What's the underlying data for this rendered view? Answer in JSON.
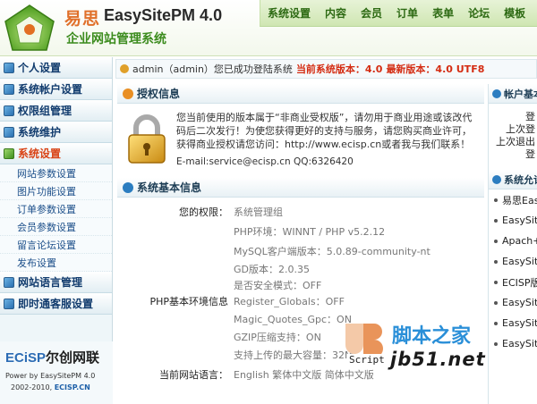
{
  "header": {
    "brand_cn": "易思",
    "brand_en": "EasySitePM 4.0",
    "subtitle": "企业网站管理系统",
    "nav": [
      "系统设置",
      "内容",
      "会员",
      "订单",
      "表单",
      "论坛",
      "模板"
    ]
  },
  "sidebar": {
    "sections": [
      {
        "label": "个人设置"
      },
      {
        "label": "系统帐户设置"
      },
      {
        "label": "权限组管理"
      },
      {
        "label": "系统维护"
      },
      {
        "label": "系统设置"
      }
    ],
    "sub_items": [
      "网站参数设置",
      "图片功能设置",
      "订单参数设置",
      "会员参数设置",
      "留言论坛设置",
      "发布设置"
    ],
    "bottom_sections": [
      {
        "label": "网站语言管理"
      },
      {
        "label": "即时通客服设置"
      }
    ],
    "footer": {
      "brand_a": "ECiSP",
      "brand_b": "尔创网联",
      "power": "Power by EasySitePM 4.0",
      "copy_a": "2002-2010,",
      "copy_b": "ECISP.CN"
    }
  },
  "welcome": {
    "user": "admin（admin）您已成功登陆系统",
    "version_label": "当前系统版本：4.0",
    "latest_label": "最新版本：4.0 UTF8"
  },
  "auth_panel": {
    "title": "授权信息",
    "text": "您当前使用的版本属于“非商业受权版”，请勿用于商业用途或该改代码后二次发行！为使您获得更好的支持与服务，请您购买商业许可，获得商业授权请您访问：http://www.ecisp.cn或者我与我们联系！",
    "contact": "E-mail:service@ecisp.cn  QQ:6326420"
  },
  "sys_panel": {
    "title": "系统基本信息",
    "rows": [
      {
        "label": "您的权限：",
        "value": "系统管理组"
      },
      {
        "label": "",
        "value": "PHP环境：WINNT / PHP v5.2.12"
      },
      {
        "label": "",
        "value": "MySQL客户端版本：5.0.89-community-nt"
      },
      {
        "label": "",
        "value": "GD版本：2.0.35"
      },
      {
        "label": "",
        "value": "是否安全模式：OFF"
      },
      {
        "label": "PHP基本环境信息",
        "value": "Register_Globals：OFF"
      },
      {
        "label": "",
        "value": "Magic_Quotes_Gpc：ON"
      },
      {
        "label": "",
        "value": "GZIP压缩支持：ON"
      },
      {
        "label": "",
        "value": "支持上传的最大容量：32M"
      },
      {
        "label": "当前网站语言：",
        "value": "English  繁体中文版  简体中文版"
      }
    ]
  },
  "right": {
    "account_title": "帐户基本",
    "account_lines": [
      "登",
      "上次登",
      "上次退出",
      "登"
    ],
    "module_title": "系统允许",
    "modules": [
      "易思Eas",
      "EasySite",
      "Apach+P",
      "EasySite",
      "ECISP版",
      "EasySite",
      "EasySite",
      "EasySite"
    ]
  },
  "watermark": {
    "badge_text": "Script",
    "site_cn": "脚本之家",
    "site_url": "jb51.net"
  }
}
